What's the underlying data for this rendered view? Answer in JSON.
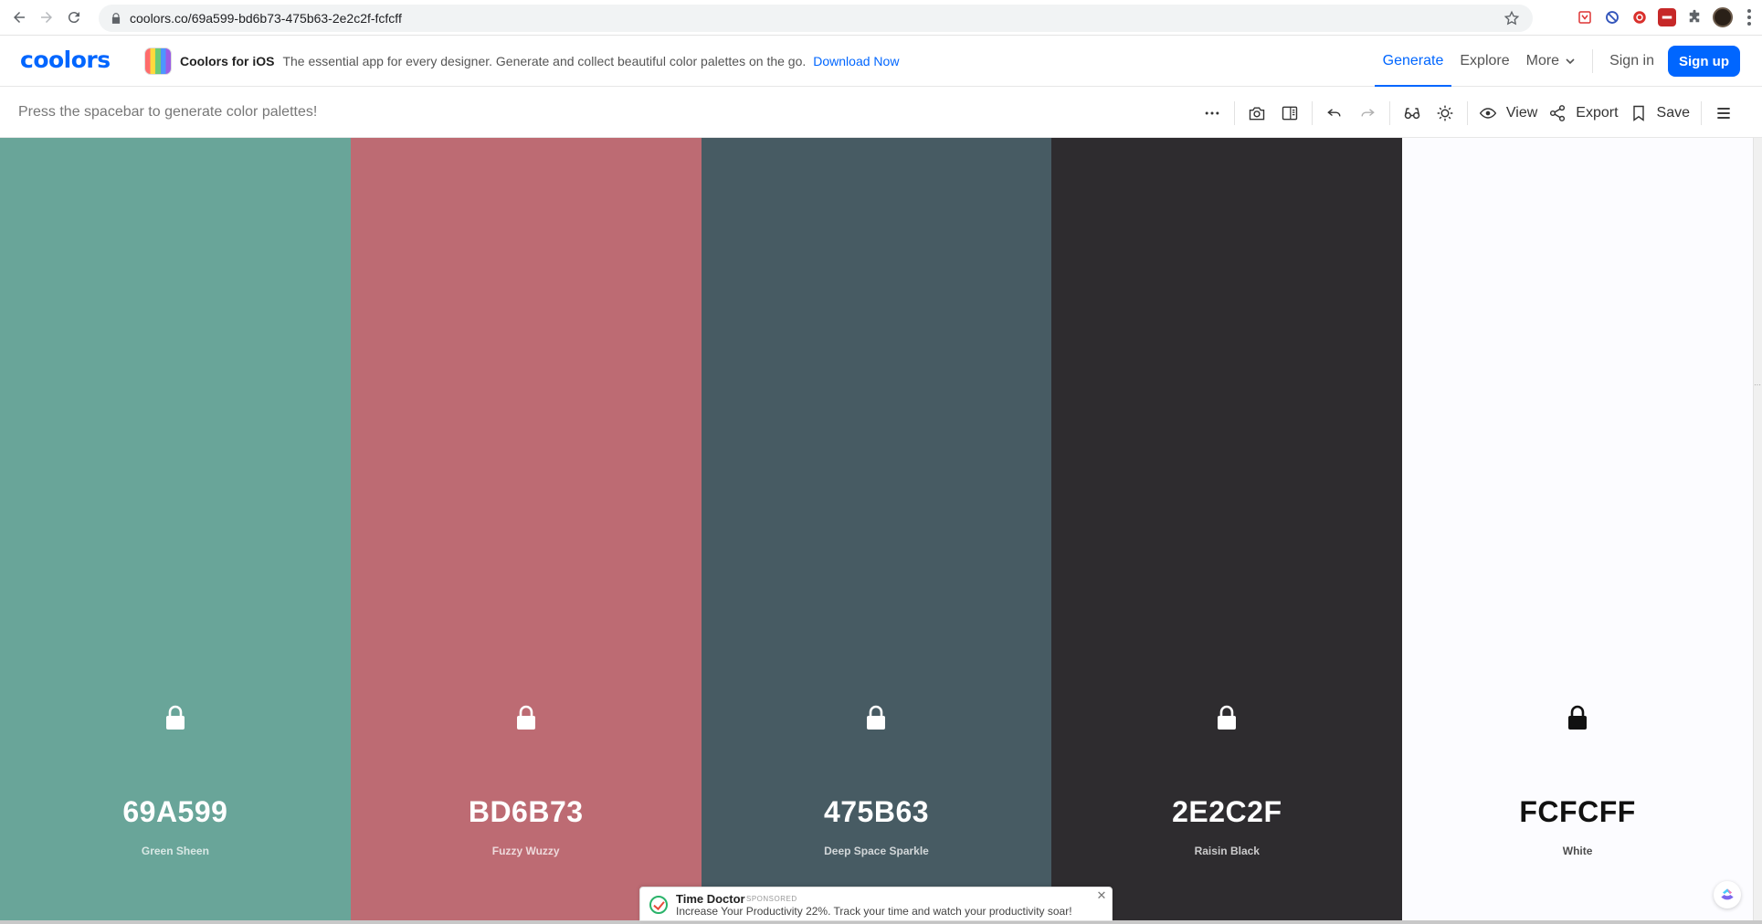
{
  "browser": {
    "url": "coolors.co/69a599-bd6b73-475b63-2e2c2f-fcfcff",
    "icons": [
      "back-icon",
      "forward-icon",
      "reload-icon",
      "lock-icon",
      "star-icon",
      "extension-icon",
      "profile-avatar",
      "menu-kebab-icon"
    ]
  },
  "header": {
    "logo": "coolors",
    "promo": {
      "title": "Coolors for iOS",
      "text": "The essential app for every designer. Generate and collect beautiful color palettes on the go.",
      "link": "Download Now"
    },
    "nav": {
      "generate": "Generate",
      "explore": "Explore",
      "more": "More",
      "sign_in": "Sign in",
      "sign_up": "Sign up"
    }
  },
  "toolbar": {
    "hint": "Press the spacebar to generate color palettes!",
    "view_label": "View",
    "export_label": "Export",
    "save_label": "Save"
  },
  "palette": [
    {
      "hex": "69A599",
      "name": "Green Sheen",
      "color": "#69A599",
      "text_color": "#ffffff"
    },
    {
      "hex": "BD6B73",
      "name": "Fuzzy Wuzzy",
      "color": "#BD6B73",
      "text_color": "#ffffff"
    },
    {
      "hex": "475B63",
      "name": "Deep Space Sparkle",
      "color": "#475B63",
      "text_color": "#ffffff"
    },
    {
      "hex": "2E2C2F",
      "name": "Raisin Black",
      "color": "#2E2C2F",
      "text_color": "#ffffff"
    },
    {
      "hex": "FCFCFF",
      "name": "White",
      "color": "#FCFCFF",
      "text_color": "#111111"
    }
  ],
  "ad": {
    "title": "Time Doctor",
    "sponsored": "SPONSORED",
    "text": "Increase Your Productivity 22%. Track your time and watch your productivity soar!"
  },
  "colors": {
    "accent": "#0066ff"
  }
}
